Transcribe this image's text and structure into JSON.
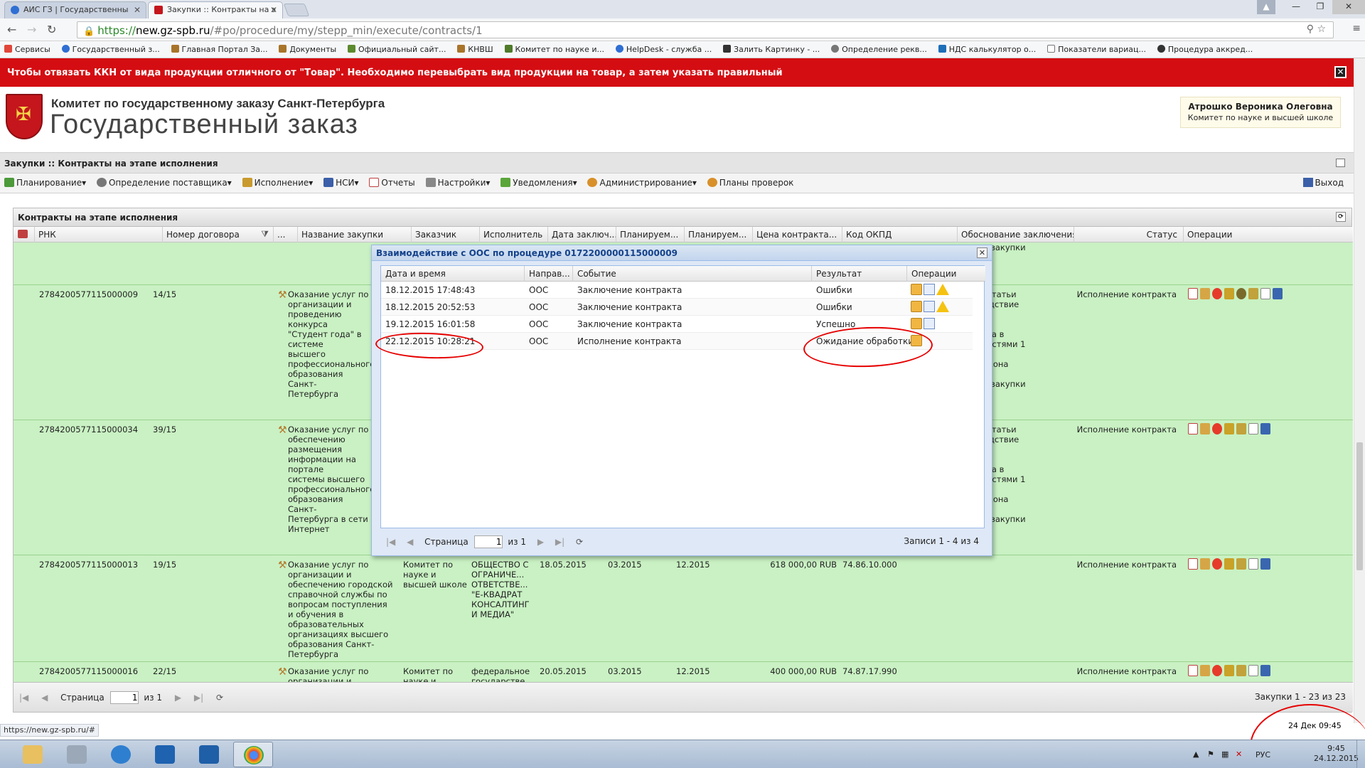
{
  "browser": {
    "tabs": [
      {
        "title": "АИС ГЗ | Государственны",
        "active": false
      },
      {
        "title": "Закупки :: Контракты на э",
        "active": true
      }
    ],
    "url": {
      "scheme": "https://",
      "host": "new.gz-spb.ru",
      "path": "/#po/procedure/my/stepp_min/execute/contracts/1"
    },
    "bookmarks": [
      "Сервисы",
      "Государственный з...",
      "Главная Портал За...",
      "Документы",
      "Официальный сайт...",
      "КНВШ",
      "Комитет по науке и...",
      "HelpDesk - служба ...",
      "Залить Картинку - ...",
      "Определение рекв...",
      "НДС калькулятор о...",
      "Показатели вариац...",
      "Процедура аккред..."
    ],
    "status_url": "https://new.gz-spb.ru/#"
  },
  "notice": {
    "text": "Чтобы отвязать ККН от вида продукции отличного от \"Товар\". Необходимо перевыбрать вид продукции на товар, а затем указать правильный",
    "close": "✕"
  },
  "header": {
    "org_line1": "Комитет по государственному заказу Санкт-Петербурга",
    "org_line2": "Государственный заказ",
    "user_name": "Атрошко Вероника Олеговна",
    "user_org": "Комитет по науке и высшей школе"
  },
  "section_title": "Закупки :: Контракты на этапе исполнения",
  "toolbar": {
    "items": [
      "Планирование",
      "Определение поставщика",
      "Исполнение",
      "НСИ",
      "Отчеты",
      "Настройки",
      "Уведомления",
      "Администрирование",
      "Планы проверок"
    ],
    "exit": "Выход"
  },
  "grid": {
    "title": "Контракты на этапе исполнения",
    "columns": [
      "РНК",
      "Номер договора",
      "...",
      "Название закупки",
      "Заказчик",
      "Исполнитель",
      "Дата заключ...",
      "Планируем...",
      "Планируем...",
      "Цена контракта...",
      "Код ОКПД",
      "Обоснование заключения",
      "Статус",
      "Операции"
    ],
    "rows": [
      {
        "rnk": "",
        "num": "",
        "name": "",
        "customer": "",
        "executor": "",
        "date": "",
        "plan1": "",
        "plan2": "",
        "price": "",
        "okpd": "",
        "basis": "нении закупки у\nого\nя (подрядчика,\nля)",
        "status": ""
      },
      {
        "rnk": "2784200577115000009",
        "num": "14/15",
        "name": "Оказание услуг по\nорганизации и\nпроведению конкурса\n\"Студент года\" в системе\nвысшего\nпрофессионального\nобразования Санкт-\nПетербурга",
        "customer": "",
        "executor": "",
        "date": "",
        "plan1": "",
        "plan2": "",
        "price": "",
        "okpd": "",
        "basis": "кт 25 статьи\nв вследствие\n\nимися\nонкурса в\nии с частями 1\n55\nого закона\n5\nнении закупки у\nого\nя (подрядчика,\nля)",
        "status": "Исполнение контракта"
      },
      {
        "rnk": "2784200577115000034",
        "num": "39/15",
        "name": "Оказание услуг по\nобеспечению\nразмещения\nинформации на портале\nсистемы высшего\nпрофессионального\nобразования Санкт-\nПетербурга в сети\nИнтернет",
        "customer": "",
        "executor": "",
        "date": "",
        "plan1": "",
        "plan2": "",
        "price": "",
        "okpd": "",
        "basis": "кт 25 статьи\nв вследствие\n\nимися\nонкурса в\nии с частями 1\n55\nого закона\n5\nнении закупки у\nого\nя (подрядчика,\nля)",
        "status": "Исполнение контракта"
      },
      {
        "rnk": "2784200577115000013",
        "num": "19/15",
        "name": "Оказание услуг по\nорганизации и\nобеспечению городской\nсправочной службы по\nвопросам поступления\nи обучения в\nобразовательных\nорганизациях высшего\nобразования Санкт-\nПетербурга",
        "customer": "Комитет по\nнауке и\nвысшей школе",
        "executor": "ОБЩЕСТВО С\nОГРАНИЧЕ...\nОТВЕТСТВЕ...\n\"Е-КВАДРАТ\nКОНСАЛТИНГ\nИ МЕДИА\"",
        "date": "18.05.2015",
        "plan1": "03.2015",
        "plan2": "12.2015",
        "price": "618 000,00 RUB",
        "okpd": "74.86.10.000",
        "basis": "",
        "status": "Исполнение контракта"
      },
      {
        "rnk": "2784200577115000016",
        "num": "22/15",
        "name": "Оказание услуг по\nорганизации и",
        "customer": "Комитет по\nнауке и",
        "executor": "федеральное\nгосударстве...",
        "date": "20.05.2015",
        "plan1": "03.2015",
        "plan2": "12.2015",
        "price": "400 000,00 RUB",
        "okpd": "74.87.17.990",
        "basis": "",
        "status": "Исполнение контракта"
      }
    ],
    "pager_label": "Страница",
    "page": "1",
    "of": "из 1",
    "records": "Закупки 1 - 23 из 23"
  },
  "modal": {
    "title": "Взаимодействие с ООС по процедуре 0172200000115000009",
    "columns": [
      "Дата и время",
      "Направ...",
      "Событие",
      "Результат",
      "Операции"
    ],
    "rows": [
      {
        "datetime": "18.12.2015 17:48:43",
        "direction": "ООС",
        "event": "Заключение контракта",
        "result": "Ошибки",
        "icons": [
          "box",
          "doc",
          "warn"
        ]
      },
      {
        "datetime": "18.12.2015 20:52:53",
        "direction": "ООС",
        "event": "Заключение контракта",
        "result": "Ошибки",
        "icons": [
          "box",
          "doc",
          "warn"
        ]
      },
      {
        "datetime": "19.12.2015 16:01:58",
        "direction": "ООС",
        "event": "Заключение контракта",
        "result": "Успешно",
        "icons": [
          "box",
          "doc"
        ]
      },
      {
        "datetime": "22.12.2015 10:28:21",
        "direction": "ООС",
        "event": "Исполнение контракта",
        "result": "Ожидание обработки",
        "icons": [
          "box"
        ]
      }
    ],
    "pager_label": "Страница",
    "page": "1",
    "of": "из 1",
    "records": "Записи 1 - 4 из 4"
  },
  "datebar": "24 Дек 09:45",
  "taskbar": {
    "lang": "РУС",
    "time": "9:45",
    "date": "24.12.2015"
  },
  "colors": {
    "notice_red": "#d40d12",
    "row_green": "#c9f1c3",
    "annotation_red": "#e60000"
  }
}
